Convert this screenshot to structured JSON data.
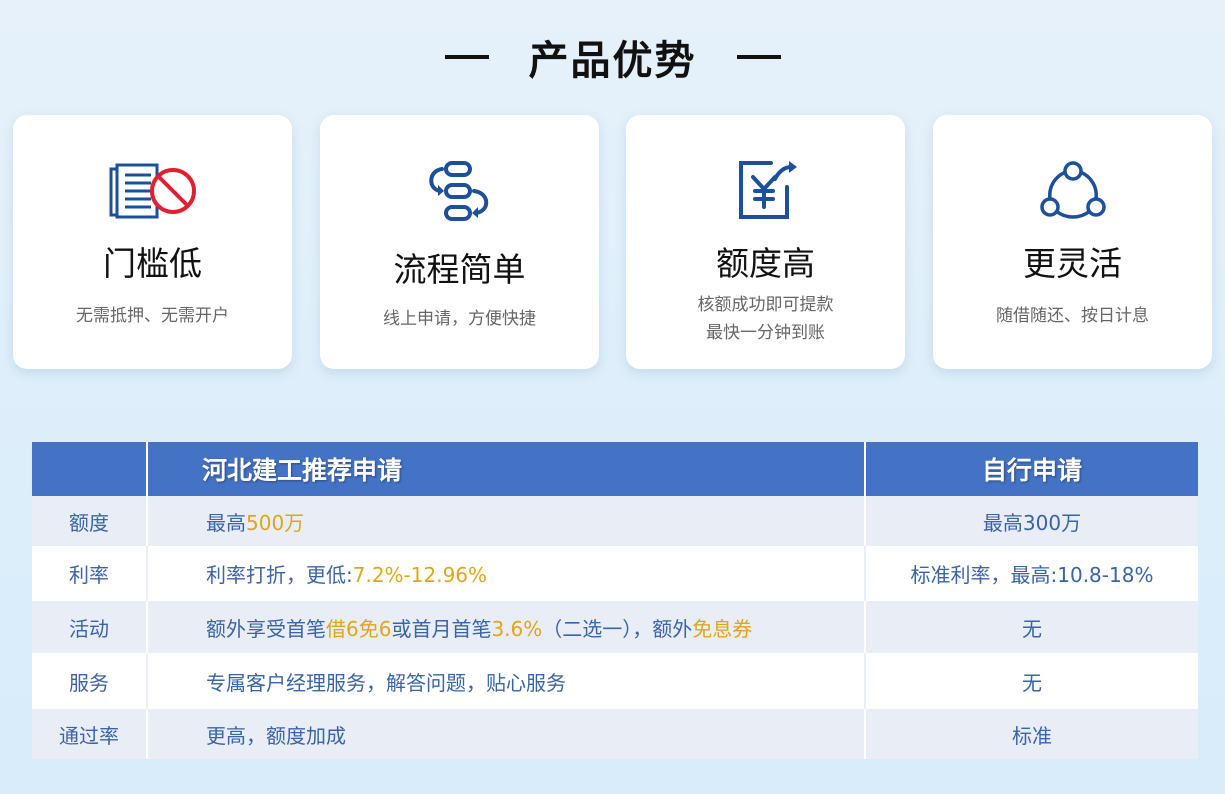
{
  "title": "产品优势",
  "cards": [
    {
      "title": "门槛低",
      "desc": [
        "无需抵押、无需开户"
      ],
      "icon": "no-documents-icon"
    },
    {
      "title": "流程简单",
      "desc": [
        "线上申请，方便快捷"
      ],
      "icon": "flow-cycle-icon"
    },
    {
      "title": "额度高",
      "desc": [
        "核额成功即可提款",
        "最快一分钟到账"
      ],
      "icon": "yuan-rise-icon"
    },
    {
      "title": "更灵活",
      "desc": [
        "随借随还、按日计息"
      ],
      "icon": "network-nodes-icon"
    }
  ],
  "table": {
    "headers": [
      "",
      "河北建工推荐申请",
      "自行申请"
    ],
    "rows": [
      {
        "label": "额度",
        "mid": [
          {
            "t": "最高"
          },
          {
            "t": "500万",
            "hl": true
          }
        ],
        "right": "最高300万"
      },
      {
        "label": "利率",
        "mid": [
          {
            "t": "利率打折，更低:"
          },
          {
            "t": "7.2%-12.96%",
            "hl": true
          }
        ],
        "right": "标准利率，最高:10.8-18%"
      },
      {
        "label": "活动",
        "mid": [
          {
            "t": "额外享受首笔"
          },
          {
            "t": "借6免6",
            "hl": true
          },
          {
            "t": "或首月首笔"
          },
          {
            "t": "3.6%",
            "hl": true
          },
          {
            "t": "（二选一），额外"
          },
          {
            "t": "免息券",
            "hl": true
          }
        ],
        "right": "无"
      },
      {
        "label": "服务",
        "mid": [
          {
            "t": "专属客户经理服务，解答问题，贴心服务"
          }
        ],
        "right": "无"
      },
      {
        "label": "通过率",
        "mid": [
          {
            "t": "更高，额度加成"
          }
        ],
        "right": "标准"
      }
    ]
  },
  "colors": {
    "header_bg": "#4472c4",
    "text_blue": "#3a64a8",
    "highlight": "#e0a61a",
    "icon_blue": "#1c4f9c",
    "icon_red": "#e02030"
  }
}
